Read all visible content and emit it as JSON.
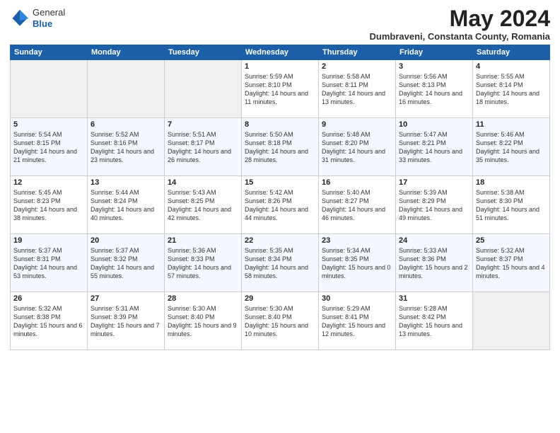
{
  "header": {
    "logo": {
      "line1": "General",
      "line2": "Blue"
    },
    "title": "May 2024",
    "subtitle": "Dumbraveni, Constanta County, Romania"
  },
  "weekdays": [
    "Sunday",
    "Monday",
    "Tuesday",
    "Wednesday",
    "Thursday",
    "Friday",
    "Saturday"
  ],
  "weeks": [
    [
      {
        "day": null
      },
      {
        "day": null
      },
      {
        "day": null
      },
      {
        "day": "1",
        "sunrise": "Sunrise: 5:59 AM",
        "sunset": "Sunset: 8:10 PM",
        "daylight": "Daylight: 14 hours and 11 minutes."
      },
      {
        "day": "2",
        "sunrise": "Sunrise: 5:58 AM",
        "sunset": "Sunset: 8:11 PM",
        "daylight": "Daylight: 14 hours and 13 minutes."
      },
      {
        "day": "3",
        "sunrise": "Sunrise: 5:56 AM",
        "sunset": "Sunset: 8:13 PM",
        "daylight": "Daylight: 14 hours and 16 minutes."
      },
      {
        "day": "4",
        "sunrise": "Sunrise: 5:55 AM",
        "sunset": "Sunset: 8:14 PM",
        "daylight": "Daylight: 14 hours and 18 minutes."
      }
    ],
    [
      {
        "day": "5",
        "sunrise": "Sunrise: 5:54 AM",
        "sunset": "Sunset: 8:15 PM",
        "daylight": "Daylight: 14 hours and 21 minutes."
      },
      {
        "day": "6",
        "sunrise": "Sunrise: 5:52 AM",
        "sunset": "Sunset: 8:16 PM",
        "daylight": "Daylight: 14 hours and 23 minutes."
      },
      {
        "day": "7",
        "sunrise": "Sunrise: 5:51 AM",
        "sunset": "Sunset: 8:17 PM",
        "daylight": "Daylight: 14 hours and 26 minutes."
      },
      {
        "day": "8",
        "sunrise": "Sunrise: 5:50 AM",
        "sunset": "Sunset: 8:18 PM",
        "daylight": "Daylight: 14 hours and 28 minutes."
      },
      {
        "day": "9",
        "sunrise": "Sunrise: 5:48 AM",
        "sunset": "Sunset: 8:20 PM",
        "daylight": "Daylight: 14 hours and 31 minutes."
      },
      {
        "day": "10",
        "sunrise": "Sunrise: 5:47 AM",
        "sunset": "Sunset: 8:21 PM",
        "daylight": "Daylight: 14 hours and 33 minutes."
      },
      {
        "day": "11",
        "sunrise": "Sunrise: 5:46 AM",
        "sunset": "Sunset: 8:22 PM",
        "daylight": "Daylight: 14 hours and 35 minutes."
      }
    ],
    [
      {
        "day": "12",
        "sunrise": "Sunrise: 5:45 AM",
        "sunset": "Sunset: 8:23 PM",
        "daylight": "Daylight: 14 hours and 38 minutes."
      },
      {
        "day": "13",
        "sunrise": "Sunrise: 5:44 AM",
        "sunset": "Sunset: 8:24 PM",
        "daylight": "Daylight: 14 hours and 40 minutes."
      },
      {
        "day": "14",
        "sunrise": "Sunrise: 5:43 AM",
        "sunset": "Sunset: 8:25 PM",
        "daylight": "Daylight: 14 hours and 42 minutes."
      },
      {
        "day": "15",
        "sunrise": "Sunrise: 5:42 AM",
        "sunset": "Sunset: 8:26 PM",
        "daylight": "Daylight: 14 hours and 44 minutes."
      },
      {
        "day": "16",
        "sunrise": "Sunrise: 5:40 AM",
        "sunset": "Sunset: 8:27 PM",
        "daylight": "Daylight: 14 hours and 46 minutes."
      },
      {
        "day": "17",
        "sunrise": "Sunrise: 5:39 AM",
        "sunset": "Sunset: 8:29 PM",
        "daylight": "Daylight: 14 hours and 49 minutes."
      },
      {
        "day": "18",
        "sunrise": "Sunrise: 5:38 AM",
        "sunset": "Sunset: 8:30 PM",
        "daylight": "Daylight: 14 hours and 51 minutes."
      }
    ],
    [
      {
        "day": "19",
        "sunrise": "Sunrise: 5:37 AM",
        "sunset": "Sunset: 8:31 PM",
        "daylight": "Daylight: 14 hours and 53 minutes."
      },
      {
        "day": "20",
        "sunrise": "Sunrise: 5:37 AM",
        "sunset": "Sunset: 8:32 PM",
        "daylight": "Daylight: 14 hours and 55 minutes."
      },
      {
        "day": "21",
        "sunrise": "Sunrise: 5:36 AM",
        "sunset": "Sunset: 8:33 PM",
        "daylight": "Daylight: 14 hours and 57 minutes."
      },
      {
        "day": "22",
        "sunrise": "Sunrise: 5:35 AM",
        "sunset": "Sunset: 8:34 PM",
        "daylight": "Daylight: 14 hours and 58 minutes."
      },
      {
        "day": "23",
        "sunrise": "Sunrise: 5:34 AM",
        "sunset": "Sunset: 8:35 PM",
        "daylight": "Daylight: 15 hours and 0 minutes."
      },
      {
        "day": "24",
        "sunrise": "Sunrise: 5:33 AM",
        "sunset": "Sunset: 8:36 PM",
        "daylight": "Daylight: 15 hours and 2 minutes."
      },
      {
        "day": "25",
        "sunrise": "Sunrise: 5:32 AM",
        "sunset": "Sunset: 8:37 PM",
        "daylight": "Daylight: 15 hours and 4 minutes."
      }
    ],
    [
      {
        "day": "26",
        "sunrise": "Sunrise: 5:32 AM",
        "sunset": "Sunset: 8:38 PM",
        "daylight": "Daylight: 15 hours and 6 minutes."
      },
      {
        "day": "27",
        "sunrise": "Sunrise: 5:31 AM",
        "sunset": "Sunset: 8:39 PM",
        "daylight": "Daylight: 15 hours and 7 minutes."
      },
      {
        "day": "28",
        "sunrise": "Sunrise: 5:30 AM",
        "sunset": "Sunset: 8:40 PM",
        "daylight": "Daylight: 15 hours and 9 minutes."
      },
      {
        "day": "29",
        "sunrise": "Sunrise: 5:30 AM",
        "sunset": "Sunset: 8:40 PM",
        "daylight": "Daylight: 15 hours and 10 minutes."
      },
      {
        "day": "30",
        "sunrise": "Sunrise: 5:29 AM",
        "sunset": "Sunset: 8:41 PM",
        "daylight": "Daylight: 15 hours and 12 minutes."
      },
      {
        "day": "31",
        "sunrise": "Sunrise: 5:28 AM",
        "sunset": "Sunset: 8:42 PM",
        "daylight": "Daylight: 15 hours and 13 minutes."
      },
      {
        "day": null
      }
    ]
  ]
}
